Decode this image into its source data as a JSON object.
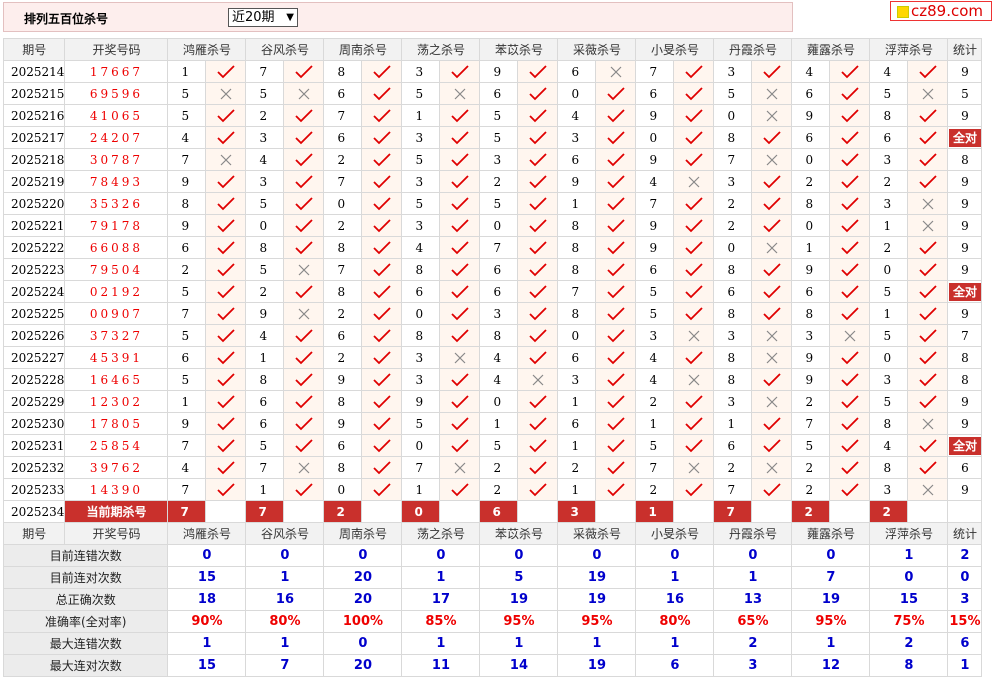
{
  "header": {
    "title": "排列五百位杀号",
    "select_value": "近20期"
  },
  "logo": {
    "text": "cz89.com"
  },
  "columns": [
    "期号",
    "开奖号码",
    "鸿雁杀号",
    "谷风杀号",
    "周南杀号",
    "荡之杀号",
    "苯苡杀号",
    "采薇杀号",
    "小旻杀号",
    "丹霞杀号",
    "蕹露杀号",
    "浮萍杀号",
    "统计"
  ],
  "rows": [
    {
      "period": "2025214",
      "draw": "17667",
      "v": [
        "1",
        "7",
        "8",
        "3",
        "9",
        "6",
        "7",
        "3",
        "4",
        "4"
      ],
      "ok": [
        1,
        1,
        1,
        1,
        1,
        0,
        1,
        1,
        1,
        1
      ],
      "count": "9"
    },
    {
      "period": "2025215",
      "draw": "69596",
      "v": [
        "5",
        "5",
        "6",
        "5",
        "6",
        "0",
        "6",
        "5",
        "6",
        "5"
      ],
      "ok": [
        0,
        0,
        1,
        0,
        1,
        1,
        1,
        0,
        1,
        0
      ],
      "count": "5"
    },
    {
      "period": "2025216",
      "draw": "41065",
      "v": [
        "5",
        "2",
        "7",
        "1",
        "5",
        "4",
        "9",
        "0",
        "9",
        "8"
      ],
      "ok": [
        1,
        1,
        1,
        1,
        1,
        1,
        1,
        0,
        1,
        1
      ],
      "count": "9"
    },
    {
      "period": "2025217",
      "draw": "24207",
      "v": [
        "4",
        "3",
        "6",
        "3",
        "5",
        "3",
        "0",
        "8",
        "6",
        "6"
      ],
      "ok": [
        1,
        1,
        1,
        1,
        1,
        1,
        1,
        1,
        1,
        1
      ],
      "count": "全对"
    },
    {
      "period": "2025218",
      "draw": "30787",
      "v": [
        "7",
        "4",
        "2",
        "5",
        "3",
        "6",
        "9",
        "7",
        "0",
        "3"
      ],
      "ok": [
        0,
        1,
        1,
        1,
        1,
        1,
        1,
        0,
        1,
        1
      ],
      "count": "8"
    },
    {
      "period": "2025219",
      "draw": "78493",
      "v": [
        "9",
        "3",
        "7",
        "3",
        "2",
        "9",
        "4",
        "3",
        "2",
        "2"
      ],
      "ok": [
        1,
        1,
        1,
        1,
        1,
        1,
        0,
        1,
        1,
        1
      ],
      "count": "9"
    },
    {
      "period": "2025220",
      "draw": "35326",
      "v": [
        "8",
        "5",
        "0",
        "5",
        "5",
        "1",
        "7",
        "2",
        "8",
        "3"
      ],
      "ok": [
        1,
        1,
        1,
        1,
        1,
        1,
        1,
        1,
        1,
        0
      ],
      "count": "9"
    },
    {
      "period": "2025221",
      "draw": "79178",
      "v": [
        "9",
        "0",
        "2",
        "3",
        "0",
        "8",
        "9",
        "2",
        "0",
        "1"
      ],
      "ok": [
        1,
        1,
        1,
        1,
        1,
        1,
        1,
        1,
        1,
        0
      ],
      "count": "9"
    },
    {
      "period": "2025222",
      "draw": "66088",
      "v": [
        "6",
        "8",
        "8",
        "4",
        "7",
        "8",
        "9",
        "0",
        "1",
        "2"
      ],
      "ok": [
        1,
        1,
        1,
        1,
        1,
        1,
        1,
        0,
        1,
        1
      ],
      "count": "9"
    },
    {
      "period": "2025223",
      "draw": "79504",
      "v": [
        "2",
        "5",
        "7",
        "8",
        "6",
        "8",
        "6",
        "8",
        "9",
        "0"
      ],
      "ok": [
        1,
        0,
        1,
        1,
        1,
        1,
        1,
        1,
        1,
        1
      ],
      "count": "9"
    },
    {
      "period": "2025224",
      "draw": "02192",
      "v": [
        "5",
        "2",
        "8",
        "6",
        "6",
        "7",
        "5",
        "6",
        "6",
        "5"
      ],
      "ok": [
        1,
        1,
        1,
        1,
        1,
        1,
        1,
        1,
        1,
        1
      ],
      "count": "全对"
    },
    {
      "period": "2025225",
      "draw": "00907",
      "v": [
        "7",
        "9",
        "2",
        "0",
        "3",
        "8",
        "5",
        "8",
        "8",
        "1"
      ],
      "ok": [
        1,
        0,
        1,
        1,
        1,
        1,
        1,
        1,
        1,
        1
      ],
      "count": "9"
    },
    {
      "period": "2025226",
      "draw": "37327",
      "v": [
        "5",
        "4",
        "6",
        "8",
        "8",
        "0",
        "3",
        "3",
        "3",
        "5"
      ],
      "ok": [
        1,
        1,
        1,
        1,
        1,
        1,
        0,
        0,
        0,
        1
      ],
      "count": "7"
    },
    {
      "period": "2025227",
      "draw": "45391",
      "v": [
        "6",
        "1",
        "2",
        "3",
        "4",
        "6",
        "4",
        "8",
        "9",
        "0"
      ],
      "ok": [
        1,
        1,
        1,
        0,
        1,
        1,
        1,
        0,
        1,
        1
      ],
      "count": "8"
    },
    {
      "period": "2025228",
      "draw": "16465",
      "v": [
        "5",
        "8",
        "9",
        "3",
        "4",
        "3",
        "4",
        "8",
        "9",
        "3"
      ],
      "ok": [
        1,
        1,
        1,
        1,
        0,
        1,
        0,
        1,
        1,
        1
      ],
      "count": "8"
    },
    {
      "period": "2025229",
      "draw": "12302",
      "v": [
        "1",
        "6",
        "8",
        "9",
        "0",
        "1",
        "2",
        "3",
        "2",
        "5"
      ],
      "ok": [
        1,
        1,
        1,
        1,
        1,
        1,
        1,
        0,
        1,
        1
      ],
      "count": "9"
    },
    {
      "period": "2025230",
      "draw": "17805",
      "v": [
        "9",
        "6",
        "9",
        "5",
        "1",
        "6",
        "1",
        "1",
        "7",
        "8"
      ],
      "ok": [
        1,
        1,
        1,
        1,
        1,
        1,
        1,
        1,
        1,
        0
      ],
      "count": "9"
    },
    {
      "period": "2025231",
      "draw": "25854",
      "v": [
        "7",
        "5",
        "6",
        "0",
        "5",
        "1",
        "5",
        "6",
        "5",
        "4"
      ],
      "ok": [
        1,
        1,
        1,
        1,
        1,
        1,
        1,
        1,
        1,
        1
      ],
      "count": "全对"
    },
    {
      "period": "2025232",
      "draw": "39762",
      "v": [
        "4",
        "7",
        "8",
        "7",
        "2",
        "2",
        "7",
        "2",
        "2",
        "8"
      ],
      "ok": [
        1,
        0,
        1,
        0,
        1,
        1,
        0,
        0,
        1,
        1
      ],
      "count": "6"
    },
    {
      "period": "2025233",
      "draw": "14390",
      "v": [
        "7",
        "1",
        "0",
        "1",
        "2",
        "1",
        "2",
        "7",
        "2",
        "3"
      ],
      "ok": [
        1,
        1,
        1,
        1,
        1,
        1,
        1,
        1,
        1,
        0
      ],
      "count": "9"
    }
  ],
  "current": {
    "period": "2025234",
    "label": "当前期杀号",
    "v": [
      "7",
      "7",
      "2",
      "0",
      "6",
      "3",
      "1",
      "7",
      "2",
      "2"
    ]
  },
  "stats": [
    {
      "label": "目前连错次数",
      "v": [
        "0",
        "0",
        "0",
        "0",
        "0",
        "0",
        "0",
        "0",
        "0",
        "1",
        "2"
      ]
    },
    {
      "label": "目前连对次数",
      "v": [
        "15",
        "1",
        "20",
        "1",
        "5",
        "19",
        "1",
        "1",
        "7",
        "0",
        "0"
      ]
    },
    {
      "label": "总正确次数",
      "v": [
        "18",
        "16",
        "20",
        "17",
        "19",
        "19",
        "16",
        "13",
        "19",
        "15",
        "3"
      ]
    },
    {
      "label": "准确率(全对率)",
      "v": [
        "90%",
        "80%",
        "100%",
        "85%",
        "95%",
        "95%",
        "80%",
        "65%",
        "95%",
        "75%",
        "15%"
      ],
      "red": true
    },
    {
      "label": "最大连错次数",
      "v": [
        "1",
        "1",
        "0",
        "1",
        "1",
        "1",
        "1",
        "2",
        "1",
        "2",
        "6"
      ]
    },
    {
      "label": "最大连对次数",
      "v": [
        "15",
        "7",
        "20",
        "11",
        "14",
        "19",
        "6",
        "3",
        "12",
        "8",
        "1"
      ]
    }
  ],
  "colors": {
    "accent": "#c9302c",
    "check": "#e00000",
    "cross": "#888888",
    "stat_blue": "#0000cc"
  }
}
